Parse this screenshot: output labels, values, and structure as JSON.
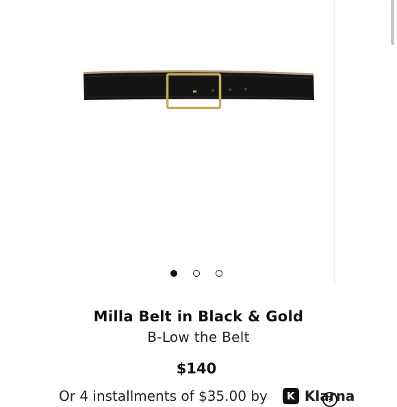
{
  "gallery": {
    "image_icon": "belt-product-image",
    "slides": [
      {
        "active": true
      },
      {
        "active": false
      },
      {
        "active": false
      }
    ]
  },
  "product": {
    "title": "Milla Belt in Black & Gold",
    "brand": "B-Low the Belt",
    "price": "$140"
  },
  "installments": {
    "text": "Or 4 installments of $35.00 by",
    "provider_badge": "K",
    "provider_name": "Klarna",
    "info_glyph": "?"
  },
  "colors": {
    "text": "#111111",
    "belt_leather": "#141414",
    "buckle_gold": "#c9a95f",
    "belt_lining": "#b99a80"
  }
}
